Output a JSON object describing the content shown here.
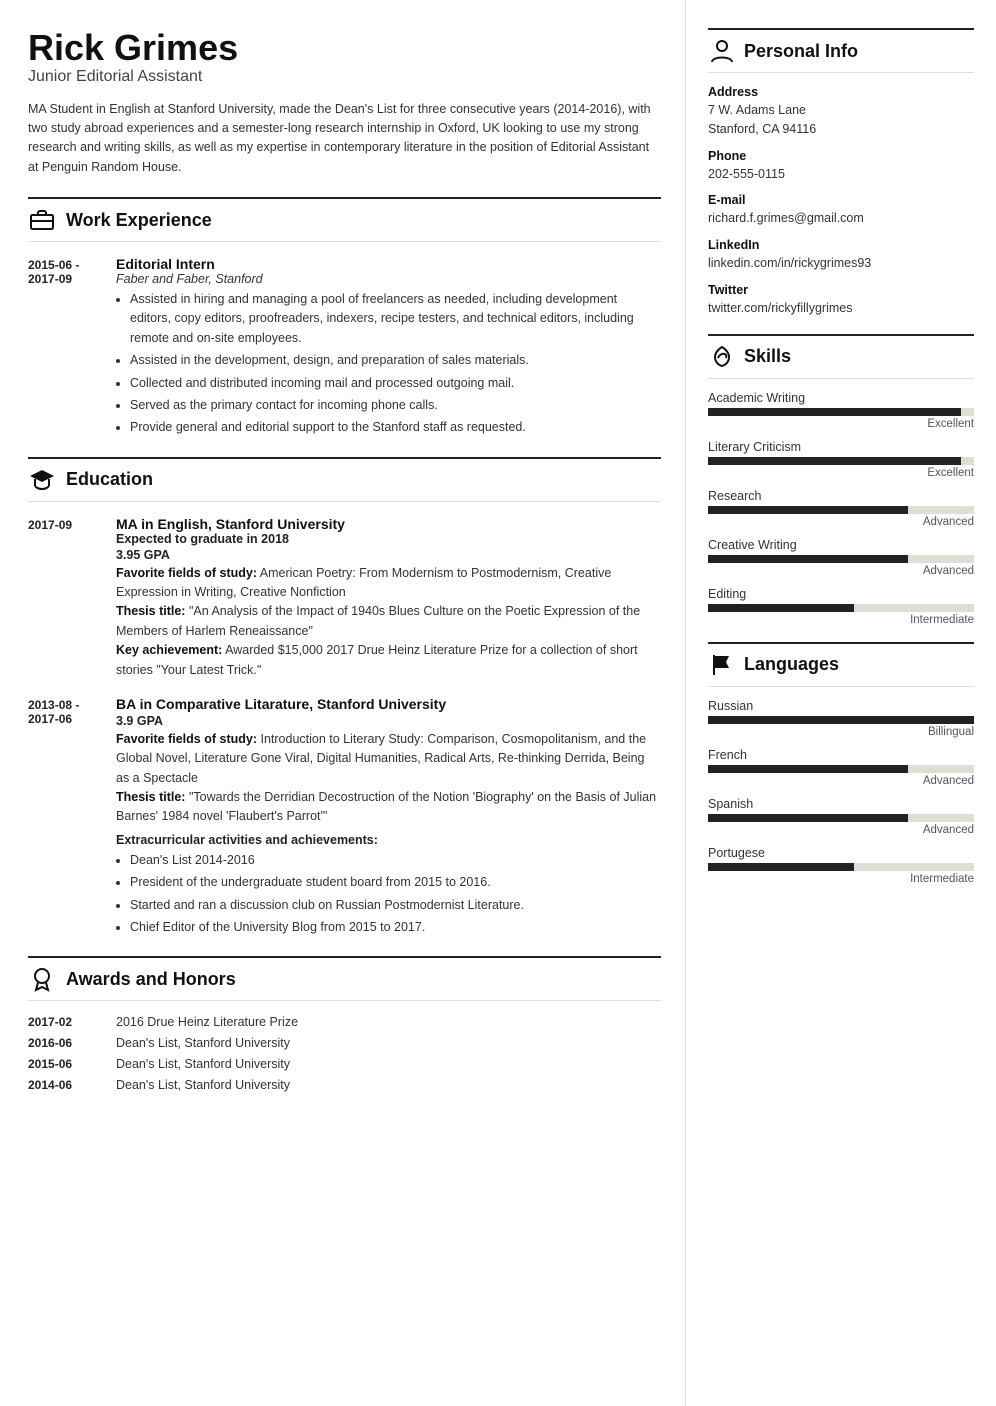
{
  "header": {
    "name": "Rick Grimes",
    "title": "Junior Editorial Assistant",
    "summary": "MA Student in English at Stanford University, made the Dean's List for three consecutive years (2014-2016), with two study abroad experiences and a semester-long research internship in Oxford, UK looking to use my strong research and writing skills, as well as my expertise in contemporary literature in the position of Editorial Assistant at Penguin Random House."
  },
  "work_experience": {
    "section_title": "Work Experience",
    "entries": [
      {
        "date": "2015-06 -\n2017-09",
        "title": "Editorial Intern",
        "org": "Faber and Faber, Stanford",
        "bullets": [
          "Assisted in hiring and managing a pool of freelancers as needed, including development editors, copy editors, proofreaders, indexers, recipe testers, and technical editors, including remote and on-site employees.",
          "Assisted in the development, design, and preparation of sales materials.",
          "Collected and distributed incoming mail and processed outgoing mail.",
          "Served as the primary contact for incoming phone calls.",
          "Provide general and editorial support to the Stanford staff as requested."
        ]
      }
    ]
  },
  "education": {
    "section_title": "Education",
    "entries": [
      {
        "date": "2017-09",
        "title": "MA in English, Stanford University",
        "expected": "Expected to graduate in 2018",
        "gpa": "3.95 GPA",
        "fields_label": "Favorite fields of study:",
        "fields": "American Poetry: From Modernism to Postmodernism, Creative Expression in Writing, Creative Nonfiction",
        "thesis_label": "Thesis title:",
        "thesis": "\"An Analysis of the Impact of 1940s Blues Culture on the Poetic Expression of the Members of Harlem Reneaissance\"",
        "achievement_label": "Key achievement:",
        "achievement": "Awarded $15,000 2017 Drue Heinz Literature Prize for a collection of short stories \"Your Latest Trick.\""
      },
      {
        "date": "2013-08 -\n2017-06",
        "title": "BA in Comparative Litarature, Stanford University",
        "gpa": "3.9 GPA",
        "fields_label": "Favorite fields of study:",
        "fields": "Introduction to Literary Study: Comparison, Cosmopolitanism, and the Global Novel, Literature Gone Viral, Digital Humanities, Radical Arts, Re-thinking Derrida, Being as a Spectacle",
        "thesis_label": "Thesis title:",
        "thesis": "\"Towards the Derridian Decostruction of the Notion 'Biography' on the Basis of Julian Barnes' 1984 novel 'Flaubert's Parrot'\"",
        "extracurricular_label": "Extracurricular activities and achievements:",
        "extracurricular_bullets": [
          "Dean's List 2014-2016",
          "President of the undergraduate student board from 2015 to 2016.",
          "Started and ran a discussion club on Russian Postmodernist Literature.",
          "Chief Editor of the University Blog from 2015 to 2017."
        ]
      }
    ]
  },
  "awards": {
    "section_title": "Awards and Honors",
    "entries": [
      {
        "date": "2017-02",
        "name": "2016 Drue Heinz Literature Prize"
      },
      {
        "date": "2016-06",
        "name": "Dean's List, Stanford University"
      },
      {
        "date": "2015-06",
        "name": "Dean's List, Stanford University"
      },
      {
        "date": "2014-06",
        "name": "Dean's List, Stanford University"
      }
    ]
  },
  "personal_info": {
    "section_title": "Personal Info",
    "address_label": "Address",
    "address": "7 W. Adams Lane\nStanford, CA 94116",
    "phone_label": "Phone",
    "phone": "202-555-0115",
    "email_label": "E-mail",
    "email": "richard.f.grimes@gmail.com",
    "linkedin_label": "LinkedIn",
    "linkedin": "linkedin.com/in/rickygrimes93",
    "twitter_label": "Twitter",
    "twitter": "twitter.com/rickyfillygrimes"
  },
  "skills": {
    "section_title": "Skills",
    "entries": [
      {
        "name": "Academic Writing",
        "level": "Excellent",
        "percent": 95
      },
      {
        "name": "Literary Criticism",
        "level": "Excellent",
        "percent": 95
      },
      {
        "name": "Research",
        "level": "Advanced",
        "percent": 75
      },
      {
        "name": "Creative Writing",
        "level": "Advanced",
        "percent": 75
      },
      {
        "name": "Editing",
        "level": "Intermediate",
        "percent": 55
      }
    ]
  },
  "languages": {
    "section_title": "Languages",
    "entries": [
      {
        "name": "Russian",
        "level": "Billingual",
        "percent": 100
      },
      {
        "name": "French",
        "level": "Advanced",
        "percent": 75
      },
      {
        "name": "Spanish",
        "level": "Advanced",
        "percent": 75
      },
      {
        "name": "Portugese",
        "level": "Intermediate",
        "percent": 55
      }
    ]
  }
}
